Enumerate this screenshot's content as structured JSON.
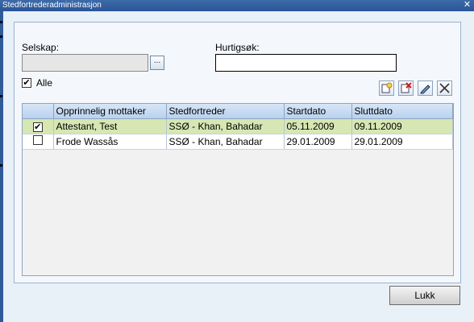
{
  "window": {
    "title": "Stedfortrederadministrasjon",
    "close_glyph": "✕"
  },
  "form": {
    "selskap_label": "Selskap:",
    "selskap_value": "",
    "browse_label": "...",
    "hurtigsok_label": "Hurtigsøk:",
    "hurtigsok_value": ""
  },
  "alle": {
    "label": "Alle",
    "checked": true
  },
  "toolbar": [
    "new-icon",
    "delete-icon",
    "edit-icon",
    "close-icon"
  ],
  "table": {
    "columns": [
      "",
      "Opprinnelig mottaker",
      "Stedfortreder",
      "Startdato",
      "Sluttdato"
    ],
    "rows": [
      {
        "checked": "✔",
        "mottaker": "Attestant, Test",
        "stedfortreder": "SSØ - Khan, Bahadar",
        "start": "05.11.2009",
        "slutt": "09.11.2009",
        "selected": true
      },
      {
        "checked": "",
        "mottaker": "Frode Wassås",
        "stedfortreder": "SSØ - Khan, Bahadar",
        "start": "29.01.2009",
        "slutt": "29.01.2009",
        "selected": false
      }
    ]
  },
  "footer": {
    "close_label": "Lukk"
  }
}
